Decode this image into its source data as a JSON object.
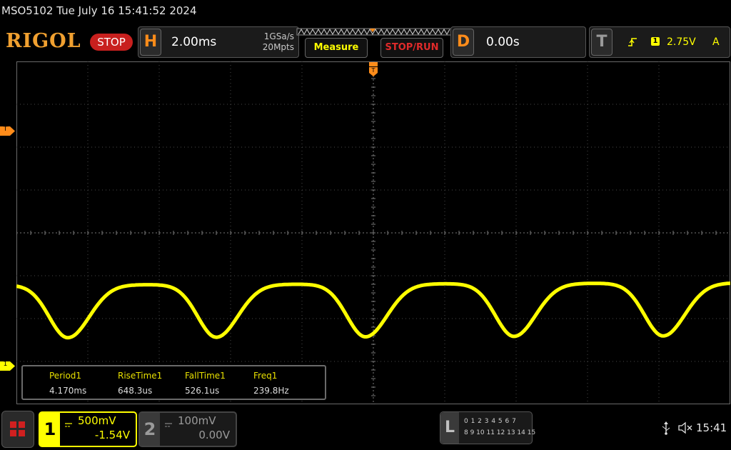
{
  "status": {
    "text": "MSO5102  Tue July 16 15:41:52 2024"
  },
  "brand": {
    "logo": "RIGOL",
    "run_state": "STOP"
  },
  "horizontal": {
    "key": "H",
    "timebase": "2.00ms",
    "sample_rate": "1GSa/s",
    "memory_depth": "20Mpts"
  },
  "buttons": {
    "measure": "Measure",
    "stop_run": "STOP/RUN"
  },
  "delay": {
    "key": "D",
    "value": "0.00s"
  },
  "trigger": {
    "key": "T",
    "channel": "1",
    "level": "2.75V",
    "mode": "A",
    "marker": "T"
  },
  "channel_markers": {
    "ch1": "1"
  },
  "measurements": [
    {
      "label": "Period1",
      "value": "4.170ms"
    },
    {
      "label": "RiseTime1",
      "value": "648.3us"
    },
    {
      "label": "FallTime1",
      "value": "526.1us"
    },
    {
      "label": "Freq1",
      "value": "239.8Hz"
    }
  ],
  "channels": [
    {
      "num": "1",
      "scale": "500mV",
      "offset": "-1.54V",
      "color": "#ffff00"
    },
    {
      "num": "2",
      "scale": "100mV",
      "offset": "0.00V",
      "color": "#9a9a9a"
    }
  ],
  "logic": {
    "key": "L",
    "row1": "0 1 2 3  4 5 6 7",
    "row2": "8 9 10 11 12 13 14 15"
  },
  "clock": {
    "time": "15:41"
  },
  "colors": {
    "trace": "#ffff00",
    "accent": "#ff8c1a",
    "stop": "#c8201e",
    "grid": "#4a4a4a"
  },
  "icons": {
    "menu": "menu-grid-icon",
    "usb": "usb-icon",
    "mute": "speaker-mute-icon",
    "trigger_edge": "rising-edge-icon"
  }
}
